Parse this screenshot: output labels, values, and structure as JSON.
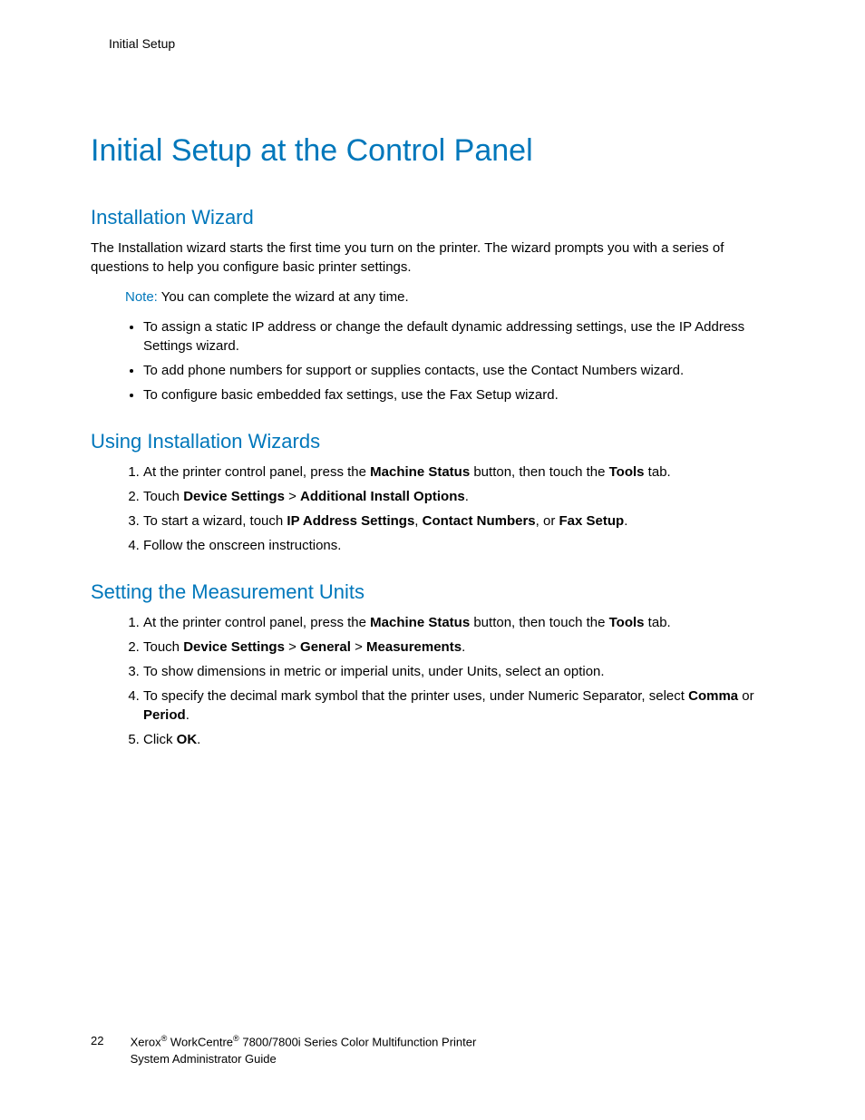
{
  "header": {
    "running": "Initial Setup"
  },
  "title": "Initial Setup at the Control Panel",
  "section1": {
    "heading": "Installation Wizard",
    "para": "The Installation wizard starts the first time you turn on the printer. The wizard prompts you with a series of questions to help you configure basic printer settings.",
    "note_label": "Note:",
    "note_text": " You can complete the wizard at any time.",
    "bullets": [
      "To assign a static IP address or change the default dynamic addressing settings, use the IP Address Settings wizard.",
      "To add phone numbers for support or supplies contacts, use the Contact Numbers wizard.",
      "To configure basic embedded fax settings, use the Fax Setup wizard."
    ]
  },
  "section2": {
    "heading": "Using Installation Wizards",
    "steps": [
      {
        "pre": "At the printer control panel, press the ",
        "b1": "Machine Status",
        "mid": " button, then touch the ",
        "b2": "Tools",
        "post": " tab."
      },
      {
        "pre": "Touch ",
        "b1": "Device Settings",
        "sep1": " > ",
        "b2": "Additional Install Options",
        "post": "."
      },
      {
        "pre": "To start a wizard, touch ",
        "b1": "IP Address Settings",
        "sep1": ", ",
        "b2": "Contact Numbers",
        "sep2": ", or ",
        "b3": "Fax Setup",
        "post": "."
      },
      {
        "pre": "Follow the onscreen instructions."
      }
    ]
  },
  "section3": {
    "heading": "Setting the Measurement Units",
    "steps": [
      {
        "pre": "At the printer control panel, press the ",
        "b1": "Machine Status",
        "mid": " button, then touch the ",
        "b2": "Tools",
        "post": " tab."
      },
      {
        "pre": "Touch ",
        "b1": "Device Settings",
        "sep1": " > ",
        "b2": "General",
        "sep2": " > ",
        "b3": "Measurements",
        "post": "."
      },
      {
        "pre": "To show dimensions in metric or imperial units, under Units, select an option."
      },
      {
        "pre": "To specify the decimal mark symbol that the printer uses, under Numeric Separator, select ",
        "b1": "Comma",
        "mid": " or ",
        "b2": "Period",
        "post": "."
      },
      {
        "pre": "Click ",
        "b1": "OK",
        "post": "."
      }
    ]
  },
  "footer": {
    "page": "22",
    "brand1": "Xerox",
    "brand2": " WorkCentre",
    "rest1": " 7800/7800i Series Color Multifunction Printer",
    "rest2": "System Administrator Guide"
  }
}
